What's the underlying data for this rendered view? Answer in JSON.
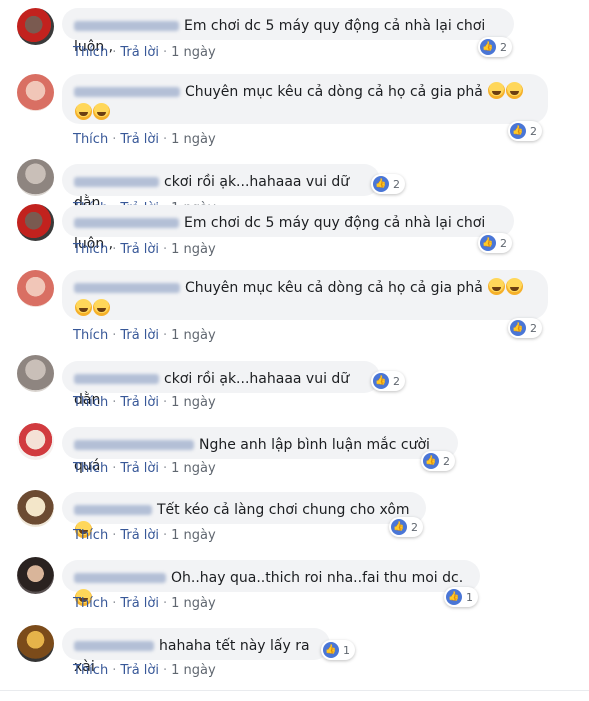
{
  "actions": {
    "like": "Thích",
    "reply": "Trả lời",
    "separator": "·"
  },
  "comments": [
    {
      "text": "Em chơi dc 5 máy quy động cả nhà lại chơi luôn ,",
      "likes": "2",
      "time": "1 ngày",
      "avatar_icon": "red-avatar-icon"
    },
    {
      "text": "Chuyên mục kêu cả dòng cả họ cả gia phả",
      "likes": "2",
      "time": "1 ngày",
      "avatar_icon": "pink-avatar-icon"
    },
    {
      "text": "ckơi rồi ạk...hahaaa vui dữ dằn",
      "likes": "2",
      "time": "1 ngày",
      "avatar_icon": "gray-avatar-icon"
    },
    {
      "text": "Em chơi dc 5 máy quy động cả nhà lại chơi luôn ,",
      "likes": "2",
      "time": "1 ngày",
      "avatar_icon": "red-avatar-icon"
    },
    {
      "text": "Chuyên mục kêu cả dòng cả họ cả gia phả",
      "likes": "2",
      "time": "1 ngày",
      "avatar_icon": "pink-avatar-icon"
    },
    {
      "text": "ckơi rồi ạk...hahaaa vui dữ dằn",
      "likes": "2",
      "time": "1 ngày",
      "avatar_icon": "gray-avatar-icon"
    },
    {
      "text": "Nghe anh lập bình luận mắc cười quá",
      "likes": "2",
      "time": "1 ngày",
      "avatar_icon": "child-avatar-icon"
    },
    {
      "text": "Tết kéo cả làng chơi chung cho xôm",
      "likes": "2",
      "time": "1 ngày",
      "avatar_icon": "girl-avatar-icon"
    },
    {
      "text": "Oh..hay qua..thich roi nha..fai thu moi dc.",
      "likes": "1",
      "time": "1 ngày",
      "avatar_icon": "dark-avatar-icon"
    },
    {
      "text": "hahaha tết này lấy ra xài",
      "likes": "1",
      "time": "1 ngày",
      "avatar_icon": "yellow-avatar-icon"
    }
  ],
  "colors": {
    "link": "#385898",
    "bubble": "#f2f3f5",
    "like_blue": "#4a76d6",
    "meta": "#606770"
  }
}
